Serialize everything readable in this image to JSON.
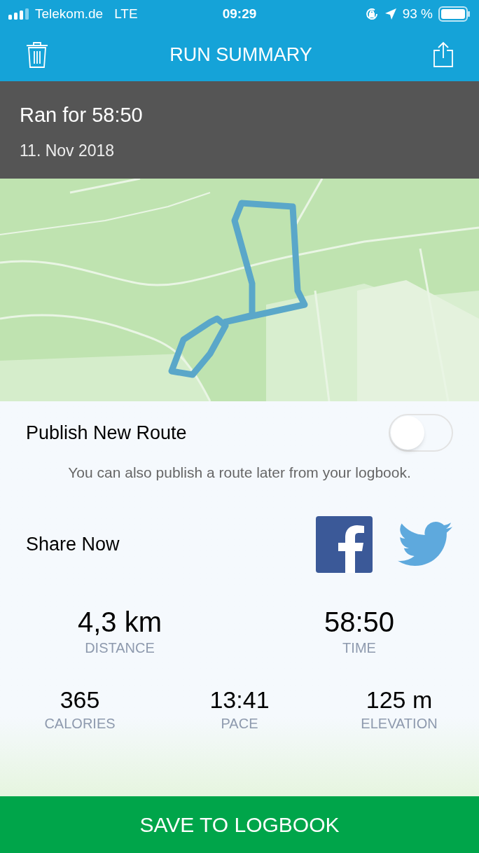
{
  "status_bar": {
    "carrier": "Telekom.de",
    "network": "LTE",
    "time": "09:29",
    "battery": "93 %"
  },
  "nav": {
    "title": "RUN SUMMARY"
  },
  "header": {
    "title": "Ran for 58:50",
    "date": "11. Nov 2018"
  },
  "publish": {
    "label": "Publish New Route",
    "on": false,
    "hint": "You can also publish a route later from your logbook."
  },
  "share": {
    "label": "Share Now"
  },
  "main_stats": [
    {
      "value": "4,3 km",
      "label": "DISTANCE"
    },
    {
      "value": "58:50",
      "label": "TIME"
    }
  ],
  "secondary_stats": [
    {
      "value": "365",
      "label": "CALORIES"
    },
    {
      "value": "13:41",
      "label": "PACE"
    },
    {
      "value": "125 m",
      "label": "ELEVATION"
    }
  ],
  "save_button": {
    "label": "SAVE TO LOGBOOK"
  }
}
